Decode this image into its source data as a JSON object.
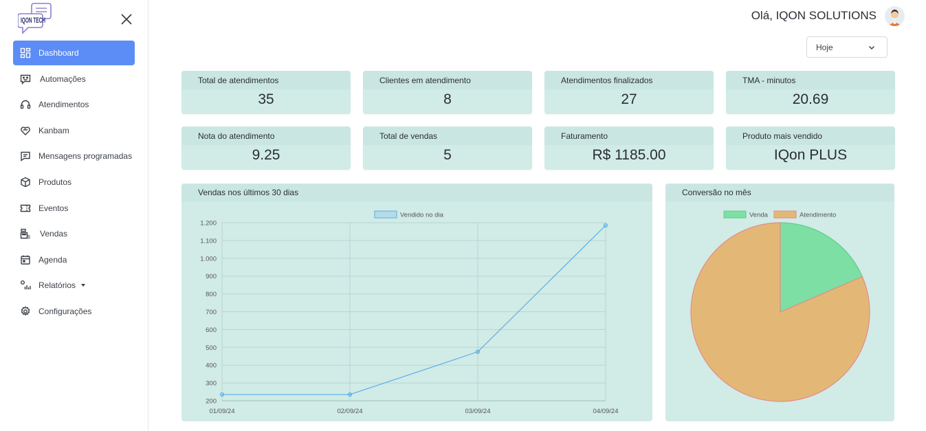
{
  "sidebar": {
    "logo_text": "IQON TECH",
    "items": [
      {
        "label": "Dashboard",
        "icon": "dashboard-icon",
        "active": true
      },
      {
        "label": "Automações",
        "icon": "chat-robot-icon"
      },
      {
        "label": "Atendimentos",
        "icon": "headset-icon"
      },
      {
        "label": "Kanbam",
        "icon": "heart-handshake-icon"
      },
      {
        "label": "Mensagens programadas",
        "icon": "message-icon"
      },
      {
        "label": "Produtos",
        "icon": "box-icon"
      },
      {
        "label": "Eventos",
        "icon": "ticket-icon"
      },
      {
        "label": "Vendas",
        "icon": "cash-register-icon"
      },
      {
        "label": "Agenda",
        "icon": "calendar-icon"
      },
      {
        "label": "Relatórios",
        "icon": "report-chart-icon"
      },
      {
        "label": "Configurações",
        "icon": "gear-icon"
      }
    ]
  },
  "header": {
    "greeting": "Olá, IQON SOLUTIONS",
    "period_select": "Hoje"
  },
  "cards": [
    {
      "label": "Total de atendimentos",
      "value": "35"
    },
    {
      "label": "Clientes em atendimento",
      "value": "8"
    },
    {
      "label": "Atendimentos finalizados",
      "value": "27"
    },
    {
      "label": "TMA - minutos",
      "value": "20.69"
    },
    {
      "label": "Nota do atendimento",
      "value": "9.25"
    },
    {
      "label": "Total de vendas",
      "value": "5"
    },
    {
      "label": "Faturamento",
      "value": "R$ 1185.00"
    },
    {
      "label": "Produto mais vendido",
      "value": "IQon PLUS"
    }
  ],
  "colors": {
    "accent": "#5c8cf5",
    "card_bg": "#d1ebe7",
    "line": "#5aaee6",
    "venda": "#7ddfa3",
    "atendimento": "#e3b877"
  },
  "chart_data": [
    {
      "type": "line",
      "title": "Vendas nos últimos 30 dias",
      "categories": [
        "01/09/24",
        "02/09/24",
        "03/09/24",
        "04/09/24"
      ],
      "series": [
        {
          "name": "Vendido no dia",
          "values": [
            235,
            235,
            475,
            1185
          ]
        }
      ],
      "ylim": [
        200,
        1200
      ],
      "yticks": [
        "200",
        "300",
        "400",
        "500",
        "600",
        "700",
        "800",
        "900",
        "1.000",
        "1.100",
        "1.200"
      ],
      "grid": true,
      "legend": "top-center"
    },
    {
      "type": "pie",
      "title": "Conversão no mês",
      "categories": [
        "Venda",
        "Atendimento"
      ],
      "values": [
        5,
        22
      ],
      "legend": "top-center"
    }
  ]
}
